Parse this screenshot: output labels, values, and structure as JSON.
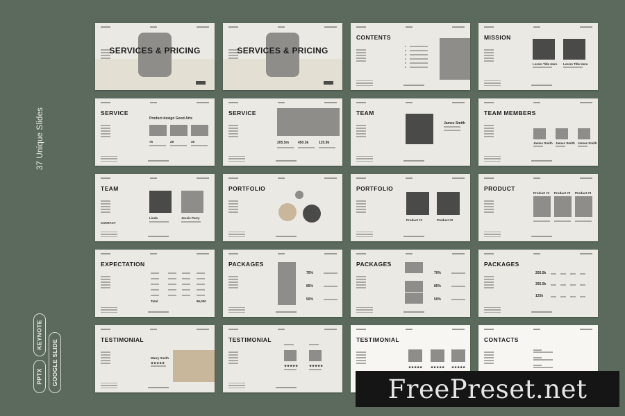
{
  "side_label": "37 Unique Slides",
  "formats": [
    "PPTX",
    "KEYNOTE",
    "GOOGLE SLIDE"
  ],
  "slides": [
    {
      "title": "SERVICES & PRICING",
      "layout": "cover"
    },
    {
      "title": "SERVICES & PRICING",
      "layout": "cover"
    },
    {
      "title": "CONTENTS",
      "layout": "contents"
    },
    {
      "title": "MISSION",
      "layout": "mission",
      "cards": [
        "Lorem Title Here",
        "Lorem Title Here"
      ]
    },
    {
      "title": "SERVICE",
      "layout": "service-1",
      "subtitle": "Product design Good Arts",
      "stats": [
        "75",
        "28",
        "35"
      ]
    },
    {
      "title": "SERVICE",
      "layout": "service-2",
      "stats": [
        "205.5m",
        "450.3k",
        "125.9k"
      ]
    },
    {
      "title": "TEAM",
      "layout": "team-1",
      "member": "James Smith"
    },
    {
      "title": "TEAM MEMBERS",
      "layout": "team-members",
      "members": [
        "James Smith",
        "James Smith",
        "James Smith"
      ]
    },
    {
      "title": "TEAM",
      "layout": "team-2",
      "members": [
        "Linda",
        "Jessie Parry"
      ],
      "extra": "CONTACT"
    },
    {
      "title": "PORTFOLIO",
      "layout": "portfolio-1"
    },
    {
      "title": "PORTFOLIO",
      "layout": "portfolio-2",
      "items": [
        "Product #1",
        "Product #2"
      ]
    },
    {
      "title": "PRODUCT",
      "layout": "product",
      "items": [
        "Product #1",
        "Product #2",
        "Product #3"
      ]
    },
    {
      "title": "EXPECTATION",
      "layout": "expectation",
      "total_label": "Total",
      "total_value": "96,000"
    },
    {
      "title": "PACKAGES",
      "layout": "packages-1",
      "percents": [
        "70%",
        "85%",
        "50%"
      ]
    },
    {
      "title": "PACKAGES",
      "layout": "packages-2",
      "percents": [
        "70%",
        "85%",
        "50%"
      ]
    },
    {
      "title": "PACKAGES",
      "layout": "packages-3",
      "prices": [
        "205.5k",
        "305.5k",
        "125k"
      ]
    },
    {
      "title": "TESTIMONIAL",
      "layout": "testimonial-1",
      "person": "Marry Smith",
      "stars": 5
    },
    {
      "title": "TESTIMONIAL",
      "layout": "testimonial-2",
      "stars": 5
    },
    {
      "title": "TESTIMONIAL",
      "layout": "testimonial-3",
      "stars": 5
    },
    {
      "title": "CONTACTS",
      "layout": "contacts"
    }
  ],
  "watermark": "FreePreset.net"
}
